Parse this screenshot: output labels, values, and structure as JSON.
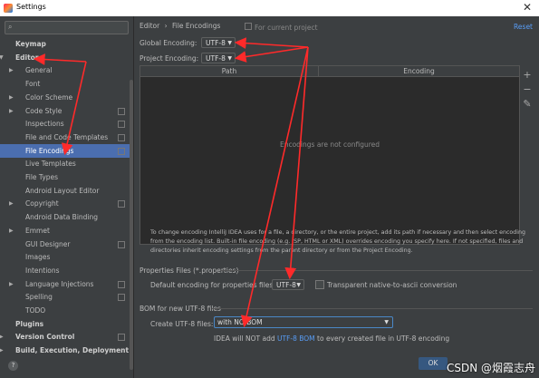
{
  "window": {
    "title": "Settings"
  },
  "sidebar": {
    "items": [
      {
        "label": "Keymap",
        "indent": 0,
        "bold": true
      },
      {
        "label": "Editor",
        "indent": 0,
        "bold": true,
        "arrow": "▼"
      },
      {
        "label": "General",
        "indent": 1,
        "arrow": "▶"
      },
      {
        "label": "Font",
        "indent": 1
      },
      {
        "label": "Color Scheme",
        "indent": 1,
        "arrow": "▶"
      },
      {
        "label": "Code Style",
        "indent": 1,
        "arrow": "▶",
        "proj": true
      },
      {
        "label": "Inspections",
        "indent": 1,
        "proj": true
      },
      {
        "label": "File and Code Templates",
        "indent": 1,
        "proj": true
      },
      {
        "label": "File Encodings",
        "indent": 1,
        "proj": true,
        "selected": true
      },
      {
        "label": "Live Templates",
        "indent": 1
      },
      {
        "label": "File Types",
        "indent": 1
      },
      {
        "label": "Android Layout Editor",
        "indent": 1
      },
      {
        "label": "Copyright",
        "indent": 1,
        "arrow": "▶",
        "proj": true
      },
      {
        "label": "Android Data Binding",
        "indent": 1
      },
      {
        "label": "Emmet",
        "indent": 1,
        "arrow": "▶"
      },
      {
        "label": "GUI Designer",
        "indent": 1,
        "proj": true
      },
      {
        "label": "Images",
        "indent": 1
      },
      {
        "label": "Intentions",
        "indent": 1
      },
      {
        "label": "Language Injections",
        "indent": 1,
        "arrow": "▶",
        "proj": true
      },
      {
        "label": "Spelling",
        "indent": 1,
        "proj": true
      },
      {
        "label": "TODO",
        "indent": 1
      },
      {
        "label": "Plugins",
        "indent": 0,
        "bold": true
      },
      {
        "label": "Version Control",
        "indent": 0,
        "bold": true,
        "arrow": "▶",
        "proj": true
      },
      {
        "label": "Build, Execution, Deployment",
        "indent": 0,
        "bold": true,
        "arrow": "▶"
      }
    ]
  },
  "header": {
    "crumb1": "Editor",
    "sep": "›",
    "crumb2": "File Encodings",
    "scope": "For current project",
    "reset": "Reset"
  },
  "encodings": {
    "global_label": "Global Encoding:",
    "global_value": "UTF-8",
    "project_label": "Project Encoding:",
    "project_value": "UTF-8"
  },
  "table": {
    "col_path": "Path",
    "col_encoding": "Encoding",
    "empty": "Encodings are not configured"
  },
  "description": "To change encoding IntelliJ IDEA uses for a file, a directory, or the entire project, add its path if necessary and then select encoding from the encoding list. Built-in file encoding (e.g. JSP, HTML or XML) overrides encoding you specify here. If not specified, files and directories inherit encoding settings from the parent directory or from the Project Encoding.",
  "properties": {
    "section": "Properties Files (*.properties)",
    "default_label": "Default encoding for properties files:",
    "default_value": "UTF-8",
    "transparent_label": "Transparent native-to-ascii conversion"
  },
  "bom": {
    "section": "BOM for new UTF-8 files",
    "create_label": "Create UTF-8 files:",
    "create_value": "with NO BOM",
    "note_pre": "IDEA will NOT add ",
    "note_link": "UTF-8 BOM",
    "note_post": " to every created file in UTF-8 encoding"
  },
  "buttons": {
    "ok": "OK"
  },
  "watermark": "CSDN @烟霞志舟",
  "colors": {
    "annotation": "#ff2a2a",
    "selection": "#4b6eaf",
    "link": "#589df6"
  }
}
